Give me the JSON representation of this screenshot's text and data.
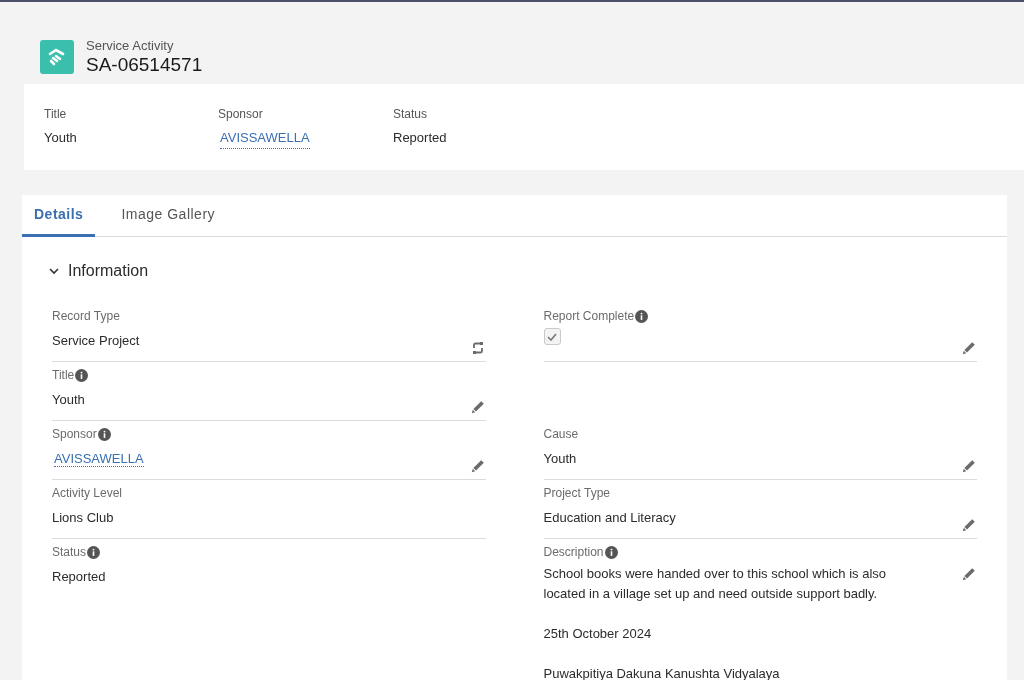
{
  "header": {
    "object_label": "Service Activity",
    "record_name": "SA-06514571"
  },
  "highlights": [
    {
      "label": "Title",
      "value": "Youth",
      "kind": "text"
    },
    {
      "label": "Sponsor",
      "value": "AVISSAWELLA",
      "kind": "link"
    },
    {
      "label": "Status",
      "value": "Reported",
      "kind": "text"
    }
  ],
  "tabs": [
    {
      "label": "Details",
      "selected": true
    },
    {
      "label": "Image Gallery",
      "selected": false
    }
  ],
  "section": {
    "title": "Information",
    "expanded": true,
    "rows": [
      {
        "left": {
          "label": "Record Type",
          "kind": "record_type",
          "value": "Service Project",
          "info": false
        },
        "right": {
          "label": "Report Complete",
          "kind": "checkbox",
          "checked": true,
          "info": true,
          "editable": true
        }
      },
      {
        "left": {
          "label": "Title",
          "kind": "text",
          "value": "Youth",
          "info": true,
          "editable": true
        }
      },
      {
        "left": {
          "label": "Sponsor",
          "kind": "link",
          "value": "AVISSAWELLA",
          "info": true,
          "editable": true
        },
        "right": {
          "label": "Cause",
          "kind": "text",
          "value": "Youth",
          "info": false,
          "editable": true
        }
      },
      {
        "left": {
          "label": "Activity Level",
          "kind": "text",
          "value": "Lions Club",
          "info": false,
          "editable": false
        },
        "right": {
          "label": "Project Type",
          "kind": "text",
          "value": "Education and Literacy",
          "info": false,
          "editable": true
        }
      },
      {
        "left": {
          "label": "Status",
          "kind": "text",
          "value": "Reported",
          "info": true,
          "editable": false
        },
        "right": {
          "label": "Description",
          "kind": "multiline",
          "paragraphs": [
            "School books were handed over to this school which is also located in a village set up and need outside support badly.",
            "25th October 2024",
            "Puwakpitiya Dakuna Kanushta Vidyalaya"
          ],
          "info": true,
          "editable": true
        }
      }
    ]
  }
}
